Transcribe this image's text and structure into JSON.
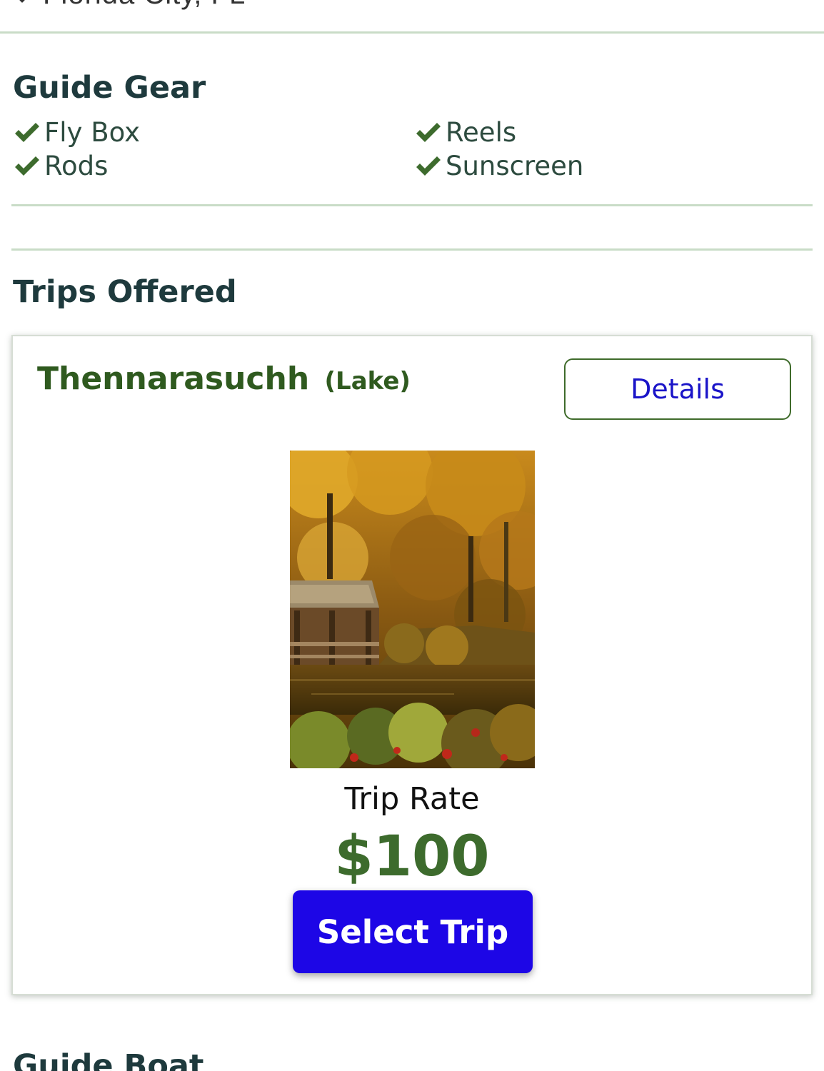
{
  "header": {
    "location": "Florida City, FL"
  },
  "guide_gear": {
    "title": "Guide Gear",
    "items": [
      "Fly Box",
      "Reels",
      "Rods",
      "Sunscreen"
    ]
  },
  "trips": {
    "title": "Trips Offered",
    "card": {
      "name": "Thennarasuchh",
      "type": "(Lake)",
      "details_label": "Details",
      "rate_label": "Trip Rate",
      "rate_value": "$100",
      "select_label": "Select Trip"
    }
  },
  "next_section": {
    "title": "Guide Boat"
  },
  "colors": {
    "accent_green": "#3d6b2d",
    "heading": "#1e3a3d",
    "primary_button": "#1d06e6",
    "link_blue": "#1a14c8",
    "divider": "#c9dcc7"
  },
  "icons": {
    "check": "check-icon",
    "location": "location-pin-icon"
  }
}
